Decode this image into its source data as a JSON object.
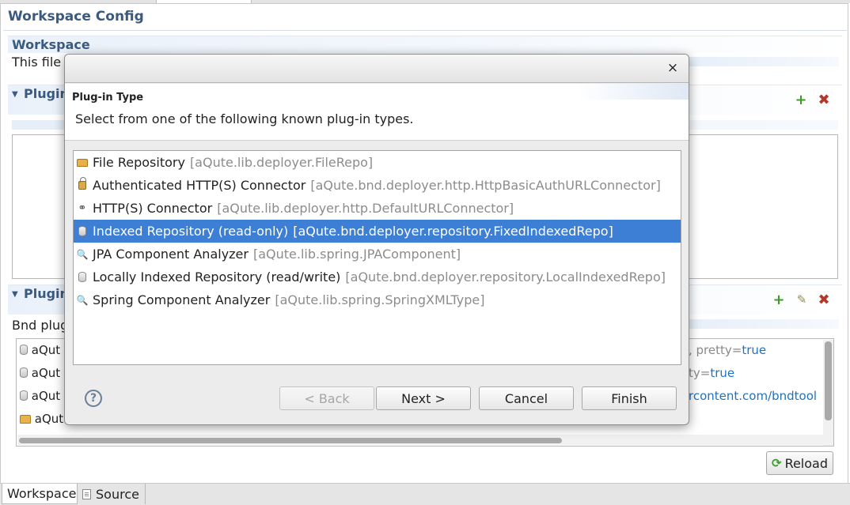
{
  "editor": {
    "title": "Workspace Config",
    "workspace_section": {
      "title": "Workspace",
      "description": "This file"
    },
    "plugin_path_section": {
      "title": "Plugin"
    },
    "plugins_section": {
      "title": "Plugin",
      "description": "Bnd plug",
      "rows": [
        {
          "icon": "database-icon",
          "label": "aQut",
          "tail": ", pretty=",
          "tail_value": "true"
        },
        {
          "icon": "database-icon",
          "label": "aQut",
          "tail": "ty=",
          "tail_value": "true"
        },
        {
          "icon": "database-icon",
          "label": "aQut",
          "tail": "",
          "tail_value": "rcontent.com/bndtool"
        },
        {
          "icon": "folder-icon",
          "label": "aQut",
          "tail": "",
          "tail_value": ""
        }
      ]
    },
    "reload_label": "Reload",
    "bottom_tabs": [
      {
        "label": "Workspace",
        "active": true
      },
      {
        "label": "Source",
        "active": false
      }
    ]
  },
  "dialog": {
    "close_glyph": "×",
    "header_title": "Plug-in Type",
    "header_description": "Select from one of the following known plug-in types.",
    "items": [
      {
        "icon": "folder-open-icon",
        "name": "File Repository",
        "class": "[aQute.lib.deployer.FileRepo]",
        "selected": false
      },
      {
        "icon": "lock-icon",
        "name": "Authenticated HTTP(S) Connector",
        "class": "[aQute.bnd.deployer.http.HttpBasicAuthURLConnector]",
        "selected": false
      },
      {
        "icon": "link-icon",
        "name": "HTTP(S) Connector",
        "class": "[aQute.lib.deployer.http.DefaultURLConnector]",
        "selected": false
      },
      {
        "icon": "database-icon",
        "name": "Indexed Repository (read-only)",
        "class": "[aQute.bnd.deployer.repository.FixedIndexedRepo]",
        "selected": true
      },
      {
        "icon": "magnifier-icon",
        "name": "JPA Component Analyzer",
        "class": "[aQute.lib.spring.JPAComponent]",
        "selected": false
      },
      {
        "icon": "database-icon",
        "name": "Locally Indexed Repository (read/write)",
        "class": "[aQute.bnd.deployer.repository.LocalIndexedRepo]",
        "selected": false
      },
      {
        "icon": "magnifier-icon",
        "name": "Spring Component Analyzer",
        "class": "[aQute.lib.spring.SpringXMLType]",
        "selected": false
      }
    ],
    "help_glyph": "?",
    "buttons": {
      "back": "< Back",
      "next": "Next >",
      "cancel": "Cancel",
      "finish": "Finish"
    }
  }
}
